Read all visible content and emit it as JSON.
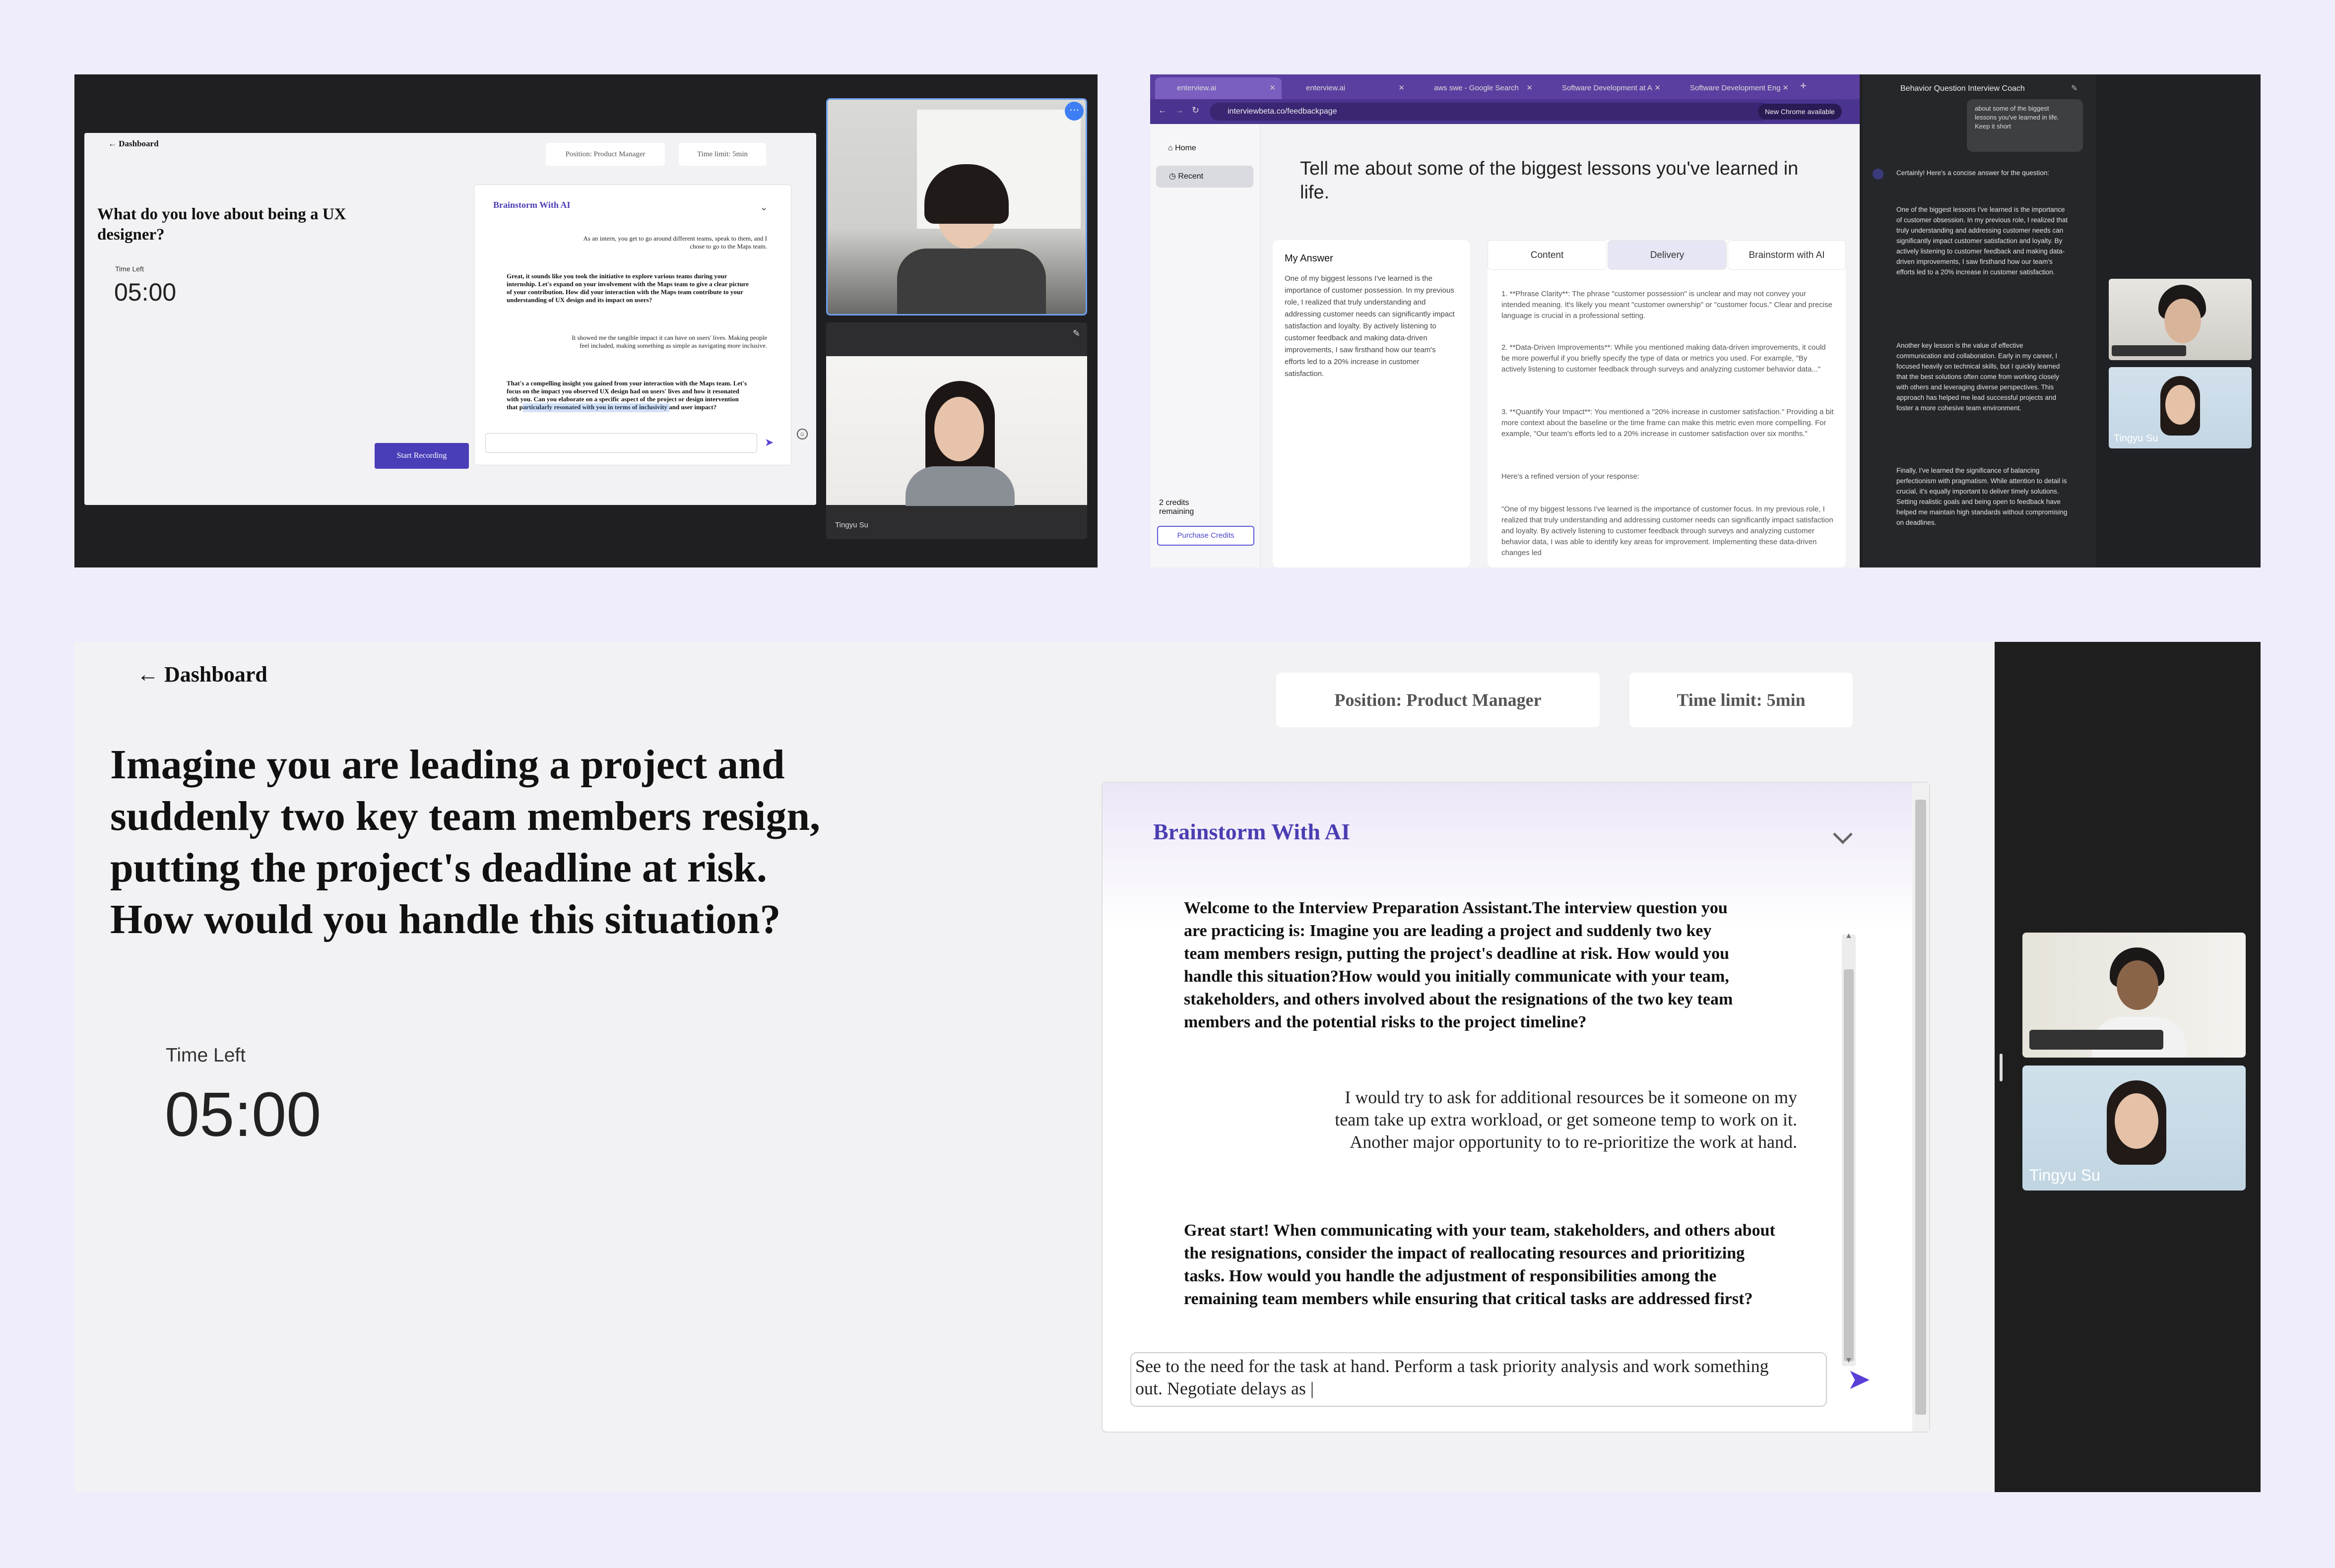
{
  "q1": {
    "back": "← Dashboard",
    "position": "Position: Product Manager",
    "time_limit": "Time limit: 5min",
    "question": "What do you love about being a UX designer?",
    "time_left_label": "Time Left",
    "timer": "05:00",
    "start_recording": "Start Recording",
    "brainstorm_title": "Brainstorm With AI",
    "msg1": "As an intern, you get to go around different teams, speak to them, and I chose to go to the Maps team.",
    "msg2": "Great, it sounds like you took the initiative to explore various teams during your internship. Let's expand on your involvement with the Maps team to give a clear picture of your contribution. How did your interaction with the Maps team contribute to your understanding of UX design and its impact on users?",
    "msg3": "It showed me the tangible impact it can have on users' lives. Making people feel included, making something as simple as navigating more inclusive.",
    "msg4": "That's a compelling insight you gained from your interaction with the Maps team. Let's focus on the impact you observed UX design had on users' lives and how it resonated with you. Can you elaborate on a specific aspect of the project or design intervention that particularly resonated with you in terms of inclusivity and user impact?",
    "participant": "Tingyu Su"
  },
  "q2": {
    "tabs": [
      "enterview.ai",
      "enterview.ai",
      "aws swe - Google Search",
      "Software Development at A",
      "Software Development Eng"
    ],
    "url": "interviewbeta.co/feedbackpage",
    "new_chrome": "New Chrome available",
    "nav_home": "Home",
    "nav_recent": "Recent",
    "credits": "2 credits remaining",
    "purchase": "Purchase Credits",
    "question": "Tell me about some of the biggest lessons you've learned in life.",
    "my_answer_title": "My Answer",
    "my_answer": "One of my biggest lessons I've learned is the importance of customer possession. In my previous role, I realized that truly understanding and addressing customer needs can significantly impact satisfaction and loyalty. By actively listening to customer feedback and making data-driven improvements, I saw firsthand how our team's efforts led to a 20% increase in customer satisfaction.",
    "tab_content": "Content",
    "tab_delivery": "Delivery",
    "tab_brainstorm": "Brainstorm with AI",
    "fb1": "1. **Phrase Clarity**: The phrase \"customer possession\" is unclear and may not convey your intended meaning. It's likely you meant \"customer ownership\" or \"customer focus.\" Clear and precise language is crucial in a professional setting.",
    "fb2": "2. **Data-Driven Improvements**: While you mentioned making data-driven improvements, it could be more powerful if you briefly specify the type of data or metrics you used. For example, \"By actively listening to customer feedback through surveys and analyzing customer behavior data...\"",
    "fb3": "3. **Quantify Your Impact**: You mentioned a \"20% increase in customer satisfaction.\" Providing a bit more context about the baseline or the time frame can make this metric even more compelling. For example, \"Our team's efforts led to a 20% increase in customer satisfaction over six months.\"",
    "fb4": "Here's a refined version of your response:",
    "fb5": "\"One of my biggest lessons I've learned is the importance of customer focus. In my previous role, I realized that truly understanding and addressing customer needs can significantly impact satisfaction and loyalty. By actively listening to customer feedback through surveys and analyzing customer behavior data, I was able to identify key areas for improvement. Implementing these data-driven changes led",
    "coach_title": "Behavior Question Interview Coach",
    "coach_user": "about some of the biggest lessons you've learned in life. Keep it short",
    "coach_p1": "Certainly! Here's a concise answer for the question:",
    "coach_p2": "One of the biggest lessons I've learned is the importance of customer obsession. In my previous role, I realized that truly understanding and addressing customer needs can significantly impact customer satisfaction and loyalty. By actively listening to customer feedback and making data-driven improvements, I saw firsthand how our team's efforts led to a 20% increase in customer satisfaction.",
    "coach_p3": "Another key lesson is the value of effective communication and collaboration. Early in my career, I focused heavily on technical skills, but I quickly learned that the best solutions often come from working closely with others and leveraging diverse perspectives. This approach has helped me lead successful projects and foster a more cohesive team environment.",
    "coach_p4": "Finally, I've learned the significance of balancing perfectionism with pragmatism. While attention to detail is crucial, it's equally important to deliver timely solutions. Setting realistic goals and being open to feedback have helped me maintain high standards without compromising on deadlines.",
    "participant": "Tingyu Su"
  },
  "q3": {
    "back": "← Dashboard",
    "position": "Position: Product Manager",
    "time_limit": "Time limit: 5min",
    "question": "Imagine you are leading a project and suddenly two key team members resign, putting the project's deadline at risk. How would you handle this situation?",
    "time_left_label": "Time Left",
    "timer": "05:00",
    "brainstorm_title": "Brainstorm With AI",
    "msg1": "Welcome to the Interview Preparation Assistant.The interview question you are practicing is: Imagine you are leading a project and suddenly two key team members resign, putting the project's deadline at risk. How would you handle this situation?How would you initially communicate with your team, stakeholders, and others involved about the resignations of the two key team members and the potential risks to the project timeline?",
    "msg2": "I would try to ask for additional resources be it someone on my team take up extra workload, or get someone temp to work on it. Another major opportunity to to re-prioritize the work at hand.",
    "msg3": "Great start! When communicating with your team, stakeholders, and others about the resignations, consider the impact of reallocating resources and prioritizing tasks. How would you handle the adjustment of responsibilities among the remaining team members while ensuring that critical tasks are addressed first?",
    "input_value": "See to the need for the task at hand. Perform a task priority analysis and work something out. Negotiate delays as |",
    "participant": "Tingyu Su"
  }
}
